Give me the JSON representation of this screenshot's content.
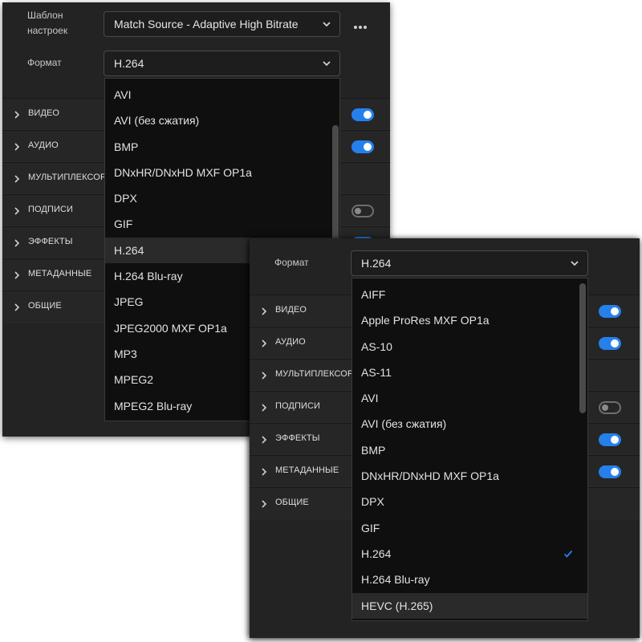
{
  "back_panel": {
    "preset": {
      "label": "Шаблон настроек",
      "value": "Match Source - Adaptive High Bitrate",
      "more_icon": "ellipsis-icon"
    },
    "format": {
      "label": "Формат",
      "value": "H.264"
    },
    "sections": [
      {
        "label": "ВИДЕО",
        "toggle": "on"
      },
      {
        "label": "АУДИО",
        "toggle": "on"
      },
      {
        "label": "МУЛЬТИПЛЕКСОР",
        "toggle": "none"
      },
      {
        "label": "ПОДПИСИ",
        "toggle": "off"
      },
      {
        "label": "ЭФФЕКТЫ",
        "toggle": "on"
      },
      {
        "label": "МЕТАДАННЫЕ",
        "toggle": "none"
      },
      {
        "label": "ОБЩИЕ",
        "toggle": "none"
      }
    ],
    "dropdown_options": [
      "AVI",
      "AVI (без сжатия)",
      "BMP",
      "DNxHR/DNxHD MXF OP1a",
      "DPX",
      "GIF",
      "H.264",
      "H.264 Blu-ray",
      "JPEG",
      "JPEG2000 MXF OP1a",
      "MP3",
      "MPEG2",
      "MPEG2 Blu-ray"
    ],
    "highlighted_option": "H.264"
  },
  "front_panel": {
    "format": {
      "label": "Формат",
      "value": "H.264"
    },
    "sections": [
      {
        "label": "ВИДЕО",
        "toggle": "on"
      },
      {
        "label": "АУДИО",
        "toggle": "on"
      },
      {
        "label": "МУЛЬТИПЛЕКСОР",
        "toggle": "none"
      },
      {
        "label": "ПОДПИСИ",
        "toggle": "off"
      },
      {
        "label": "ЭФФЕКТЫ",
        "toggle": "on"
      },
      {
        "label": "МЕТАДАННЫЕ",
        "toggle": "on"
      },
      {
        "label": "ОБЩИЕ",
        "toggle": "none"
      }
    ],
    "dropdown_options": [
      "AIFF",
      "Apple ProRes MXF OP1a",
      "AS-10",
      "AS-11",
      "AVI",
      "AVI (без сжатия)",
      "BMP",
      "DNxHR/DNxHD MXF OP1a",
      "DPX",
      "GIF",
      "H.264",
      "H.264 Blu-ray",
      "HEVC (H.265)"
    ],
    "selected_option": "H.264",
    "highlighted_option": "HEVC (H.265)"
  },
  "colors": {
    "accent": "#2680eb",
    "panel_bg": "#232323",
    "dropdown_bg": "#0f0f0f",
    "text": "#dcdcdc"
  }
}
